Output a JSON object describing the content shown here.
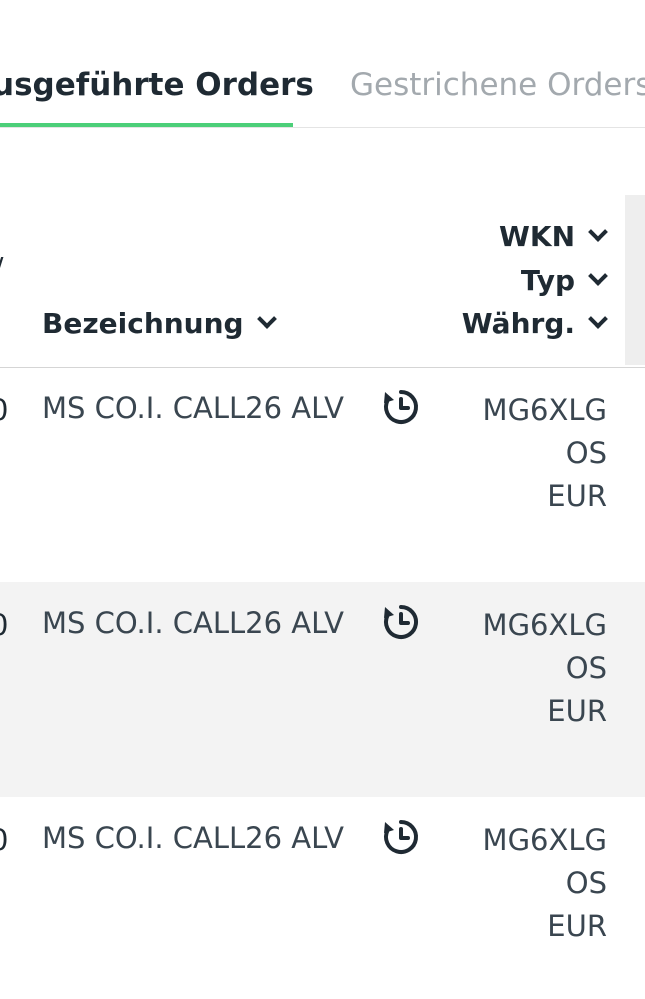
{
  "tabs": {
    "active_label": "usgeführte Orders",
    "inactive_label": "Gestrichene Orders"
  },
  "table": {
    "left_edge_header_marks": [
      "/",
      "."
    ],
    "columns": {
      "name_header": "Bezeichnung",
      "wkn_header": "WKN",
      "type_header": "Typ",
      "currency_header": "Währg."
    },
    "rows": [
      {
        "left_edge": "0",
        "name": "MS CO.I. CALL26 ALV",
        "icon": "history-icon",
        "wkn": "MG6XLG",
        "type": "OS",
        "currency": "EUR"
      },
      {
        "left_edge": "0",
        "name": "MS CO.I. CALL26 ALV",
        "icon": "history-icon",
        "wkn": "MG6XLG",
        "type": "OS",
        "currency": "EUR"
      },
      {
        "left_edge": "0",
        "name": "MS CO.I. CALL26 ALV",
        "icon": "history-icon",
        "wkn": "MG6XLG",
        "type": "OS",
        "currency": "EUR"
      }
    ]
  },
  "colors": {
    "accent": "#4ccf79",
    "text_dark": "#1f2a33",
    "text_muted": "#a3a9ae",
    "row_alt_bg": "#f3f3f3"
  }
}
